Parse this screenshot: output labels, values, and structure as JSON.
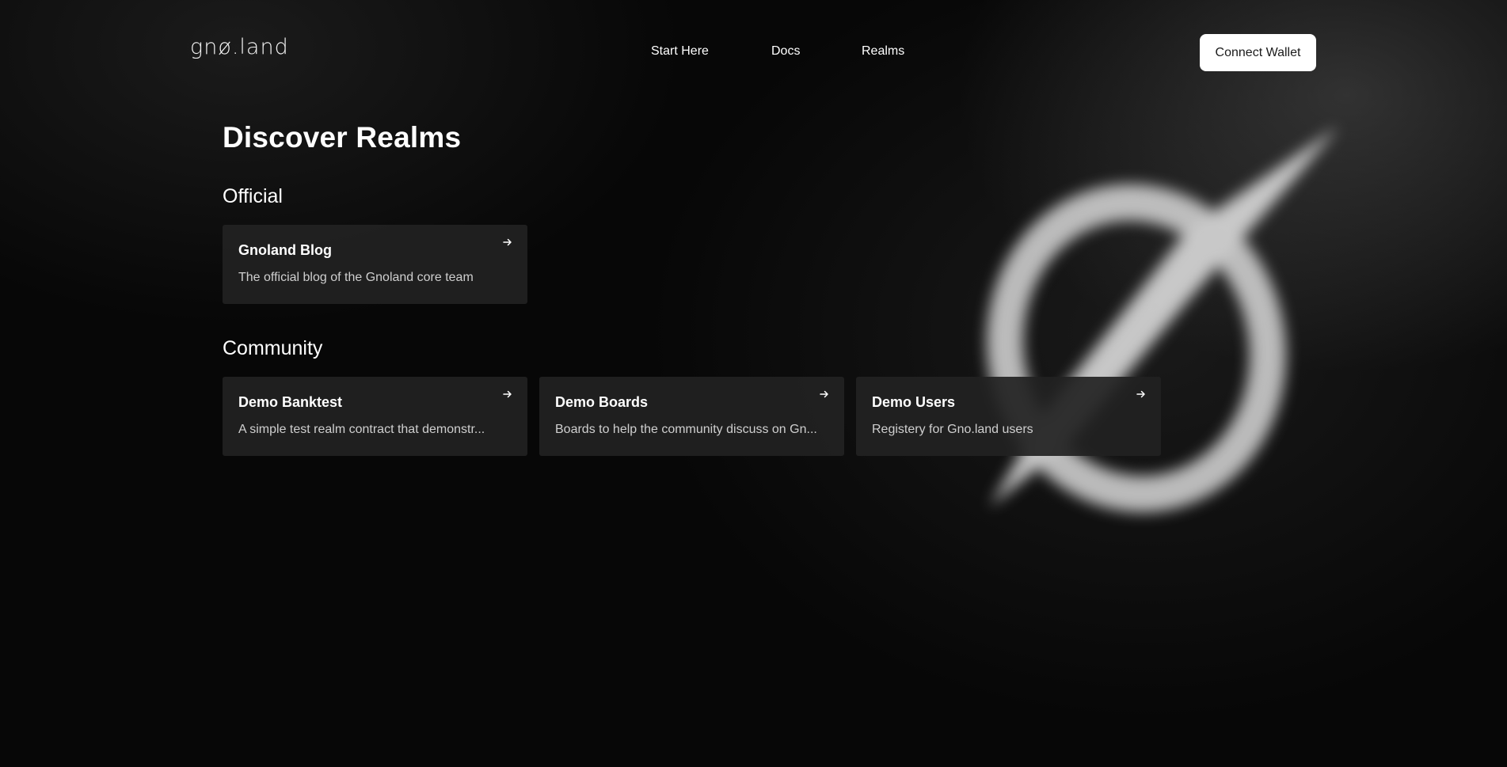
{
  "header": {
    "logo_text": "gnø.land",
    "nav": [
      {
        "label": "Start Here"
      },
      {
        "label": "Docs"
      },
      {
        "label": "Realms"
      }
    ],
    "connect_wallet_label": "Connect Wallet"
  },
  "main": {
    "title": "Discover Realms",
    "sections": [
      {
        "heading": "Official",
        "cards": [
          {
            "title": "Gnoland Blog",
            "description": "The official blog of the Gnoland core team"
          }
        ]
      },
      {
        "heading": "Community",
        "cards": [
          {
            "title": "Demo Banktest",
            "description": "A simple test realm contract that demonstr..."
          },
          {
            "title": "Demo Boards",
            "description": "Boards to help the community discuss on Gn..."
          },
          {
            "title": "Demo Users",
            "description": "Registery for Gno.land users"
          }
        ]
      }
    ]
  },
  "colors": {
    "background": "#070707",
    "card_background": "#222222",
    "button_background": "#ffffff",
    "button_text": "#1a1a1a",
    "description_text": "#cfcfcf"
  },
  "icons": {
    "card_arrow": "arrow-right-icon",
    "background_mark": "gno-logo-icon"
  }
}
